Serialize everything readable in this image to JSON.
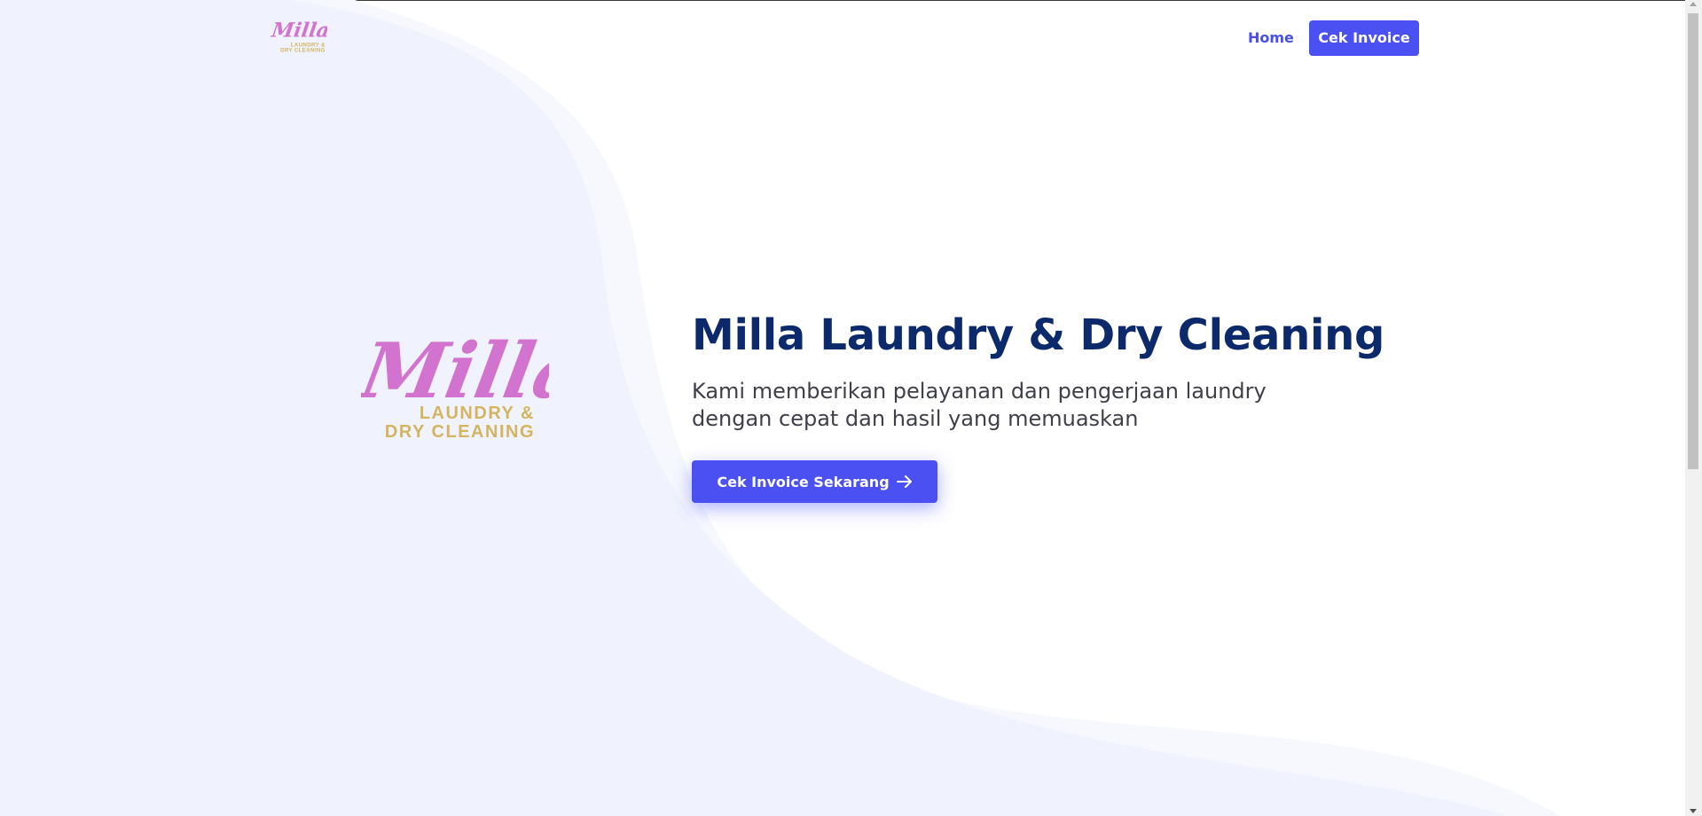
{
  "brand": {
    "logo_script": "Milla",
    "logo_line1": "LAUNDRY &",
    "logo_line2": "DRY CLEANING",
    "script_color": "#d173cf",
    "gold_color": "#d3b561"
  },
  "nav": {
    "home_label": "Home",
    "cta_label": "Cek Invoice"
  },
  "hero": {
    "title": "Milla Laundry & Dry Cleaning",
    "subtitle": "Kami memberikan pelayanan dan pengerjaan laundry dengan cepat dan hasil yang memuaskan",
    "cta_label": "Cek Invoice Sekarang",
    "cta_icon": "arrow-right-icon"
  },
  "colors": {
    "accent": "#4a50f2",
    "title": "#0c2a6b",
    "wave_light": "#f0f3fd",
    "wave_lighter": "#f6f8fe"
  }
}
